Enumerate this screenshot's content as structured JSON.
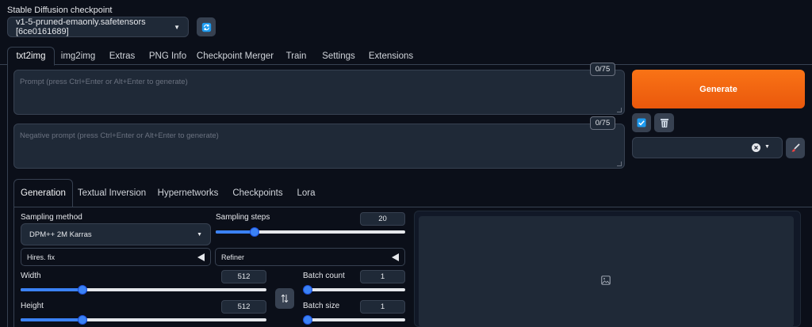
{
  "checkpoint": {
    "label": "Stable Diffusion checkpoint",
    "selected": "v1-5-pruned-emaonly.safetensors [6ce0161689]"
  },
  "tabs": [
    {
      "label": "txt2img",
      "active": true
    },
    {
      "label": "img2img"
    },
    {
      "label": "Extras"
    },
    {
      "label": "PNG Info"
    },
    {
      "label": "Checkpoint Merger"
    },
    {
      "label": "Train"
    },
    {
      "label": "Settings"
    },
    {
      "label": "Extensions"
    }
  ],
  "prompt": {
    "placeholder": "Prompt (press Ctrl+Enter or Alt+Enter to generate)",
    "counter": "0/75"
  },
  "negative_prompt": {
    "placeholder": "Negative prompt (press Ctrl+Enter or Alt+Enter to generate)",
    "counter": "0/75"
  },
  "generate_label": "Generate",
  "subtabs": [
    {
      "label": "Generation",
      "active": true
    },
    {
      "label": "Textual Inversion"
    },
    {
      "label": "Hypernetworks"
    },
    {
      "label": "Checkpoints"
    },
    {
      "label": "Lora"
    }
  ],
  "generation": {
    "sampling_method_label": "Sampling method",
    "sampling_method_value": "DPM++ 2M Karras",
    "sampling_steps_label": "Sampling steps",
    "sampling_steps_value": "20",
    "sampling_steps_fraction": 0.19,
    "hires_label": "Hires. fix",
    "refiner_label": "Refiner",
    "width_label": "Width",
    "width_value": "512",
    "width_fraction": 0.24,
    "height_label": "Height",
    "height_value": "512",
    "height_fraction": 0.24,
    "batch_count_label": "Batch count",
    "batch_count_value": "1",
    "batch_count_fraction": 0.0,
    "batch_size_label": "Batch size",
    "batch_size_value": "1",
    "batch_size_fraction": 0.0
  },
  "colors": {
    "background": "#0b0f19",
    "panel": "#1f2937",
    "border": "#374151",
    "accent": "#3b82f6",
    "generate": "#f97316"
  },
  "icons": {
    "refresh": "refresh-icon",
    "check": "checkbox-icon",
    "trash": "trash-icon",
    "clear": "close-circle-icon",
    "brush": "paintbrush-icon",
    "swap": "swap-icon",
    "image": "image-icon"
  }
}
